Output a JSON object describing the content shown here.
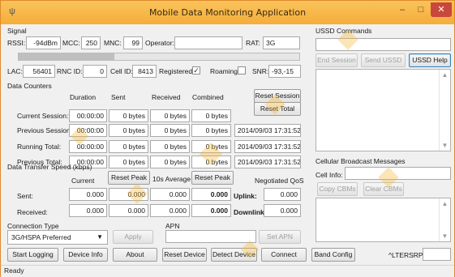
{
  "window": {
    "title": "Mobile Data Monitoring Application",
    "icon": "antenna-icon",
    "controls": {
      "minimize": "–",
      "maximize": "□",
      "close": "✕"
    }
  },
  "signal": {
    "group_label": "Signal",
    "rssi_label": "RSSI:",
    "rssi": "-94dBm",
    "mcc_label": "MCC:",
    "mcc": "250",
    "mnc_label": "MNC:",
    "mnc": "99",
    "operator_label": "Operator:",
    "operator": "",
    "rat_label": "RAT:",
    "rat": "3G",
    "signal_level_fraction": 0.34,
    "lac_label": "LAC:",
    "lac": "56401",
    "rnc_label": "RNC ID:",
    "rnc": "0",
    "cell_label": "Cell ID:",
    "cell": "8413",
    "registered_label": "Registered:",
    "registered_mark": "✓",
    "roaming_label": "Roaming:",
    "snr_label": "SNR:",
    "snr": "-93,-15"
  },
  "counters": {
    "group_label": "Data Counters",
    "headers": {
      "duration": "Duration",
      "sent": "Sent",
      "received": "Received",
      "combined": "Combined"
    },
    "reset_session": "Reset Session",
    "reset_total": "Reset Total",
    "rows": [
      {
        "label": "Current Session:",
        "duration": "00:00:00",
        "sent": "0 bytes",
        "received": "0 bytes",
        "combined": "0 bytes",
        "stamp": ""
      },
      {
        "label": "Previous Session:",
        "duration": "00:00:00",
        "sent": "0 bytes",
        "received": "0 bytes",
        "combined": "0 bytes",
        "stamp": "2014/09/03 17:31:52"
      },
      {
        "label": "Running Total:",
        "duration": "00:00:00",
        "sent": "0 bytes",
        "received": "0 bytes",
        "combined": "0 bytes",
        "stamp": "2014/09/03 17:31:52"
      },
      {
        "label": "Previous Total:",
        "duration": "00:00:00",
        "sent": "0 bytes",
        "received": "0 bytes",
        "combined": "0 bytes",
        "stamp": "2014/09/03 17:31:52"
      }
    ]
  },
  "speed": {
    "group_label": "Data Transfer Speed (kbps)",
    "current_label": "Current",
    "reset_peak_1": "Reset Peak",
    "avg_label": "10s Average",
    "reset_peak_2": "Reset Peak",
    "qos_label": "Negotiated QoS",
    "sent_label": "Sent:",
    "received_label": "Received:",
    "sent": {
      "current": "0.000",
      "peak": "0.000",
      "avg": "0.000",
      "avg_peak": "0.000"
    },
    "received": {
      "current": "0.000",
      "peak": "0.000",
      "avg": "0.000",
      "avg_peak": "0.000"
    },
    "uplink_label": "Uplink:",
    "uplink": "0.000",
    "downlink_label": "Downlink:",
    "downlink": "0.000"
  },
  "connection": {
    "type_label": "Connection Type",
    "type_value": "3G/HSPA Preferred",
    "apply": "Apply",
    "apn_label": "APN",
    "apn_value": "",
    "set_apn": "Set APN"
  },
  "ussd": {
    "group_label": "USSD Commands",
    "input_value": "",
    "end_session": "End Session",
    "send_ussd": "Send USSD",
    "help": "USSD Help"
  },
  "cbm": {
    "group_label": "Cellular Broadcast Messages",
    "cell_info_label": "Cell Info:",
    "cell_info": "",
    "copy": "Copy CBMs",
    "clear": "Clear CBMs"
  },
  "bottom": {
    "start_logging": "Start Logging",
    "device_info": "Device Info",
    "about": "About",
    "reset_device": "Reset Device",
    "detect_device": "Detect Device",
    "connect": "Connect",
    "band_config": "Band Config",
    "at_label": "^LTERSRP:",
    "at_value": ""
  },
  "status": {
    "text": "Ready"
  },
  "colors": {
    "titlebar": "#f5ad3a",
    "close": "#c9483b",
    "watermark": "#f7b733"
  }
}
